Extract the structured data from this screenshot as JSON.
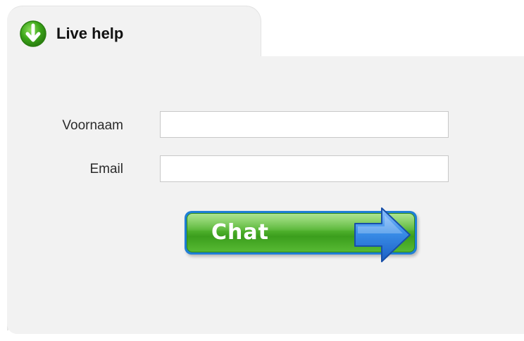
{
  "widget": {
    "tab_title": "Live help",
    "tab_icon": "down-arrow-circle-icon"
  },
  "form": {
    "voornaam_label": "Voornaam",
    "voornaam_value": "",
    "email_label": "Email",
    "email_value": "",
    "submit_label": "Chat",
    "submit_icon": "right-arrow-icon"
  },
  "colors": {
    "button_green": "#55b631",
    "button_border_blue": "#1f7fd6",
    "arrow_blue": "#2f7be0",
    "icon_green": "#3aa418",
    "panel_bg": "#f2f2f2"
  }
}
